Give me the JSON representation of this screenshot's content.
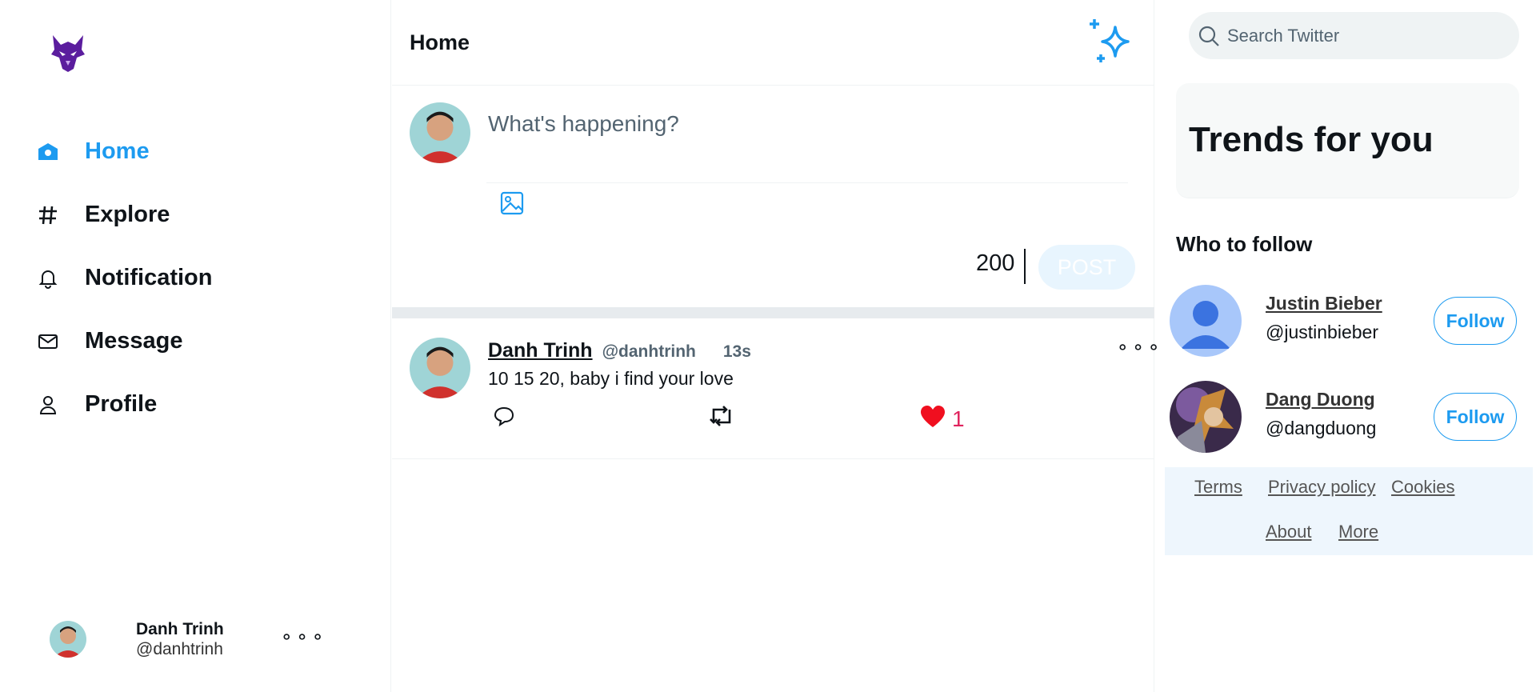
{
  "brand": {
    "logo": "wolf-logo",
    "logo_color": "#5b1d9e"
  },
  "nav": {
    "items": [
      {
        "label": "Home",
        "icon": "home-icon",
        "active": true
      },
      {
        "label": "Explore",
        "icon": "hashtag-icon",
        "active": false
      },
      {
        "label": "Notification",
        "icon": "bell-icon",
        "active": false
      },
      {
        "label": "Message",
        "icon": "mail-icon",
        "active": false
      },
      {
        "label": "Profile",
        "icon": "person-icon",
        "active": false
      }
    ],
    "accent": "#1d9bf0"
  },
  "account": {
    "name": "Danh Trinh",
    "handle": "@danhtrinh",
    "more": "⚬⚬⚬"
  },
  "main": {
    "title": "Home",
    "composer": {
      "placeholder": "What's happening?",
      "counter": "200",
      "post_label": "POST"
    },
    "tweets": [
      {
        "name": "Danh Trinh",
        "handle": "@danhtrinh",
        "time": "13s",
        "text": "10 15 20, baby i find your love",
        "likes": "1",
        "more": "⚬⚬⚬"
      }
    ]
  },
  "right": {
    "search_placeholder": "Search Twitter",
    "trends_title": "Trends for you",
    "who_to_follow_title": "Who to follow",
    "follow": [
      {
        "name": "Justin Bieber",
        "handle": "@justinbieber",
        "button": "Follow"
      },
      {
        "name": "Dang Duong",
        "handle": "@dangduong",
        "button": "Follow"
      }
    ],
    "footer_links": [
      "Terms",
      "Privacy policy",
      "Cookies",
      "About",
      "More"
    ]
  }
}
